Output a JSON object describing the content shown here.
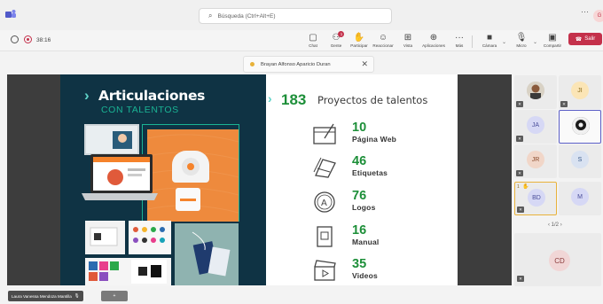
{
  "search": {
    "placeholder": "Búsqueda (Ctrl+Alt+E)"
  },
  "profile": {
    "initials": "G"
  },
  "meeting": {
    "timer": "38:16"
  },
  "toolbar": {
    "chat": "Chat",
    "people": "Gente",
    "people_badge": "1",
    "raise": "Participar",
    "react": "Reaccionar",
    "view": "Vista",
    "apps": "Aplicaciones",
    "more": "Más",
    "camera": "Cámara",
    "mic": "Micro",
    "share": "Compartir",
    "leave": "Salir"
  },
  "share_pill": {
    "presenter": "Brayan Alfonso Aparicio Duran"
  },
  "slide": {
    "title": "Articulaciones",
    "subtitle": "CON TALENTOS",
    "total_number": "183",
    "total_label": "Proyectos de talentos",
    "stats": [
      {
        "number": "10",
        "label": "Página Web",
        "icon": "web-page-icon"
      },
      {
        "number": "46",
        "label": "Etiquetas",
        "icon": "tags-icon"
      },
      {
        "number": "76",
        "label": "Logos",
        "icon": "logo-icon"
      },
      {
        "number": "16",
        "label": "Manual",
        "icon": "manual-icon"
      },
      {
        "number": "35",
        "label": "Videos",
        "icon": "video-clapper-icon"
      }
    ]
  },
  "gallery": {
    "participants": [
      "JI",
      "JA",
      "JR",
      "S",
      "BD",
      "M"
    ],
    "raised_hand_count": "1",
    "pager": "1/2",
    "bottom_participant": "CD"
  },
  "bottom_bar": {
    "user": "Laura Vanessa Mendoza Mantilla",
    "extra": "+"
  },
  "colors": {
    "accent_green": "#1d8f39",
    "teal": "#1ab394",
    "leave_red": "#c4314b",
    "slide_bg": "#0f3344"
  }
}
